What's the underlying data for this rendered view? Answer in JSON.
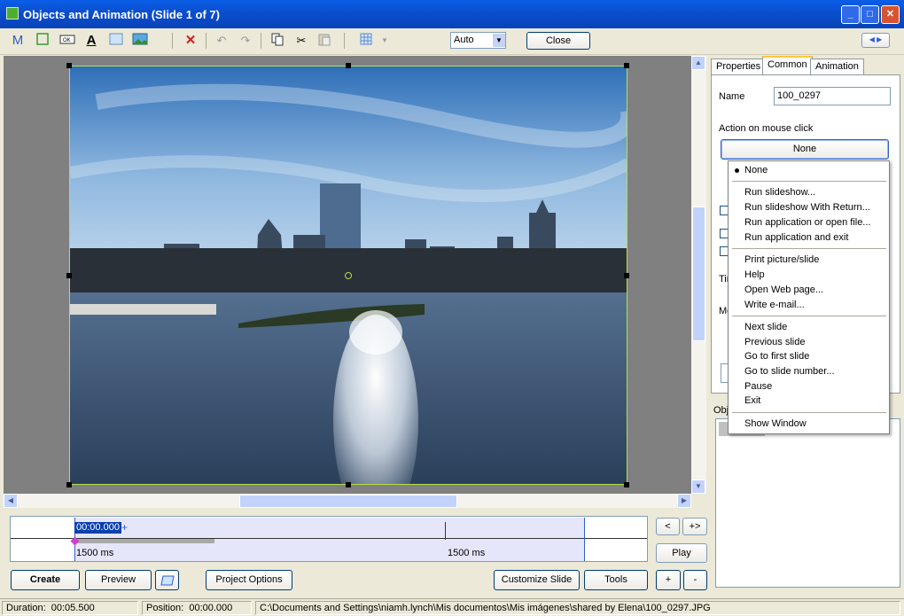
{
  "window": {
    "title": "Objects and Animation  (Slide 1 of 7)"
  },
  "toolbar": {
    "zoom_value": "Auto",
    "close_label": "Close"
  },
  "right_panel": {
    "tabs": [
      "Properties",
      "Common",
      "Animation"
    ],
    "name_label": "Name",
    "name_value": "100_0297",
    "action_label": "Action on mouse click",
    "action_value": "None",
    "partial_labels": [
      "Tir",
      "Mo",
      "Obj"
    ]
  },
  "action_menu": {
    "items": [
      {
        "label": "None",
        "selected": true
      },
      {
        "label": "Run slideshow..."
      },
      {
        "label": "Run slideshow With Return..."
      },
      {
        "label": "Run application or open file..."
      },
      {
        "label": "Run application and exit"
      },
      {
        "label": "Print picture/slide"
      },
      {
        "label": "Help"
      },
      {
        "label": "Open Web page..."
      },
      {
        "label": "Write e-mail..."
      },
      {
        "label": "Next slide"
      },
      {
        "label": "Previous slide"
      },
      {
        "label": "Go to first slide"
      },
      {
        "label": "Go to slide number..."
      },
      {
        "label": "Pause"
      },
      {
        "label": "Exit"
      },
      {
        "label": "Show Window"
      }
    ]
  },
  "timeline": {
    "time": "00:00.000",
    "plus": "+",
    "marker1": "1500 ms",
    "marker2": "1500 ms"
  },
  "side_buttons": {
    "prev": "<",
    "next": "+>",
    "play": "Play",
    "add": "+",
    "remove": "-"
  },
  "bottom_buttons": {
    "create": "Create",
    "preview": "Preview",
    "project_options": "Project Options",
    "customize_slide": "Customize Slide",
    "tools": "Tools"
  },
  "status": {
    "duration_label": "Duration:",
    "duration_value": "00:05.500",
    "position_label": "Position:",
    "position_value": "00:00.000",
    "file_path": "C:\\Documents and Settings\\niamh.lynch\\Mis documentos\\Mis imágenes\\shared by Elena\\100_0297.JPG"
  },
  "colors": {
    "accent": "#0b4fd0",
    "selection": "#b4e04a",
    "timeline_fill": "#e6e6fa"
  }
}
